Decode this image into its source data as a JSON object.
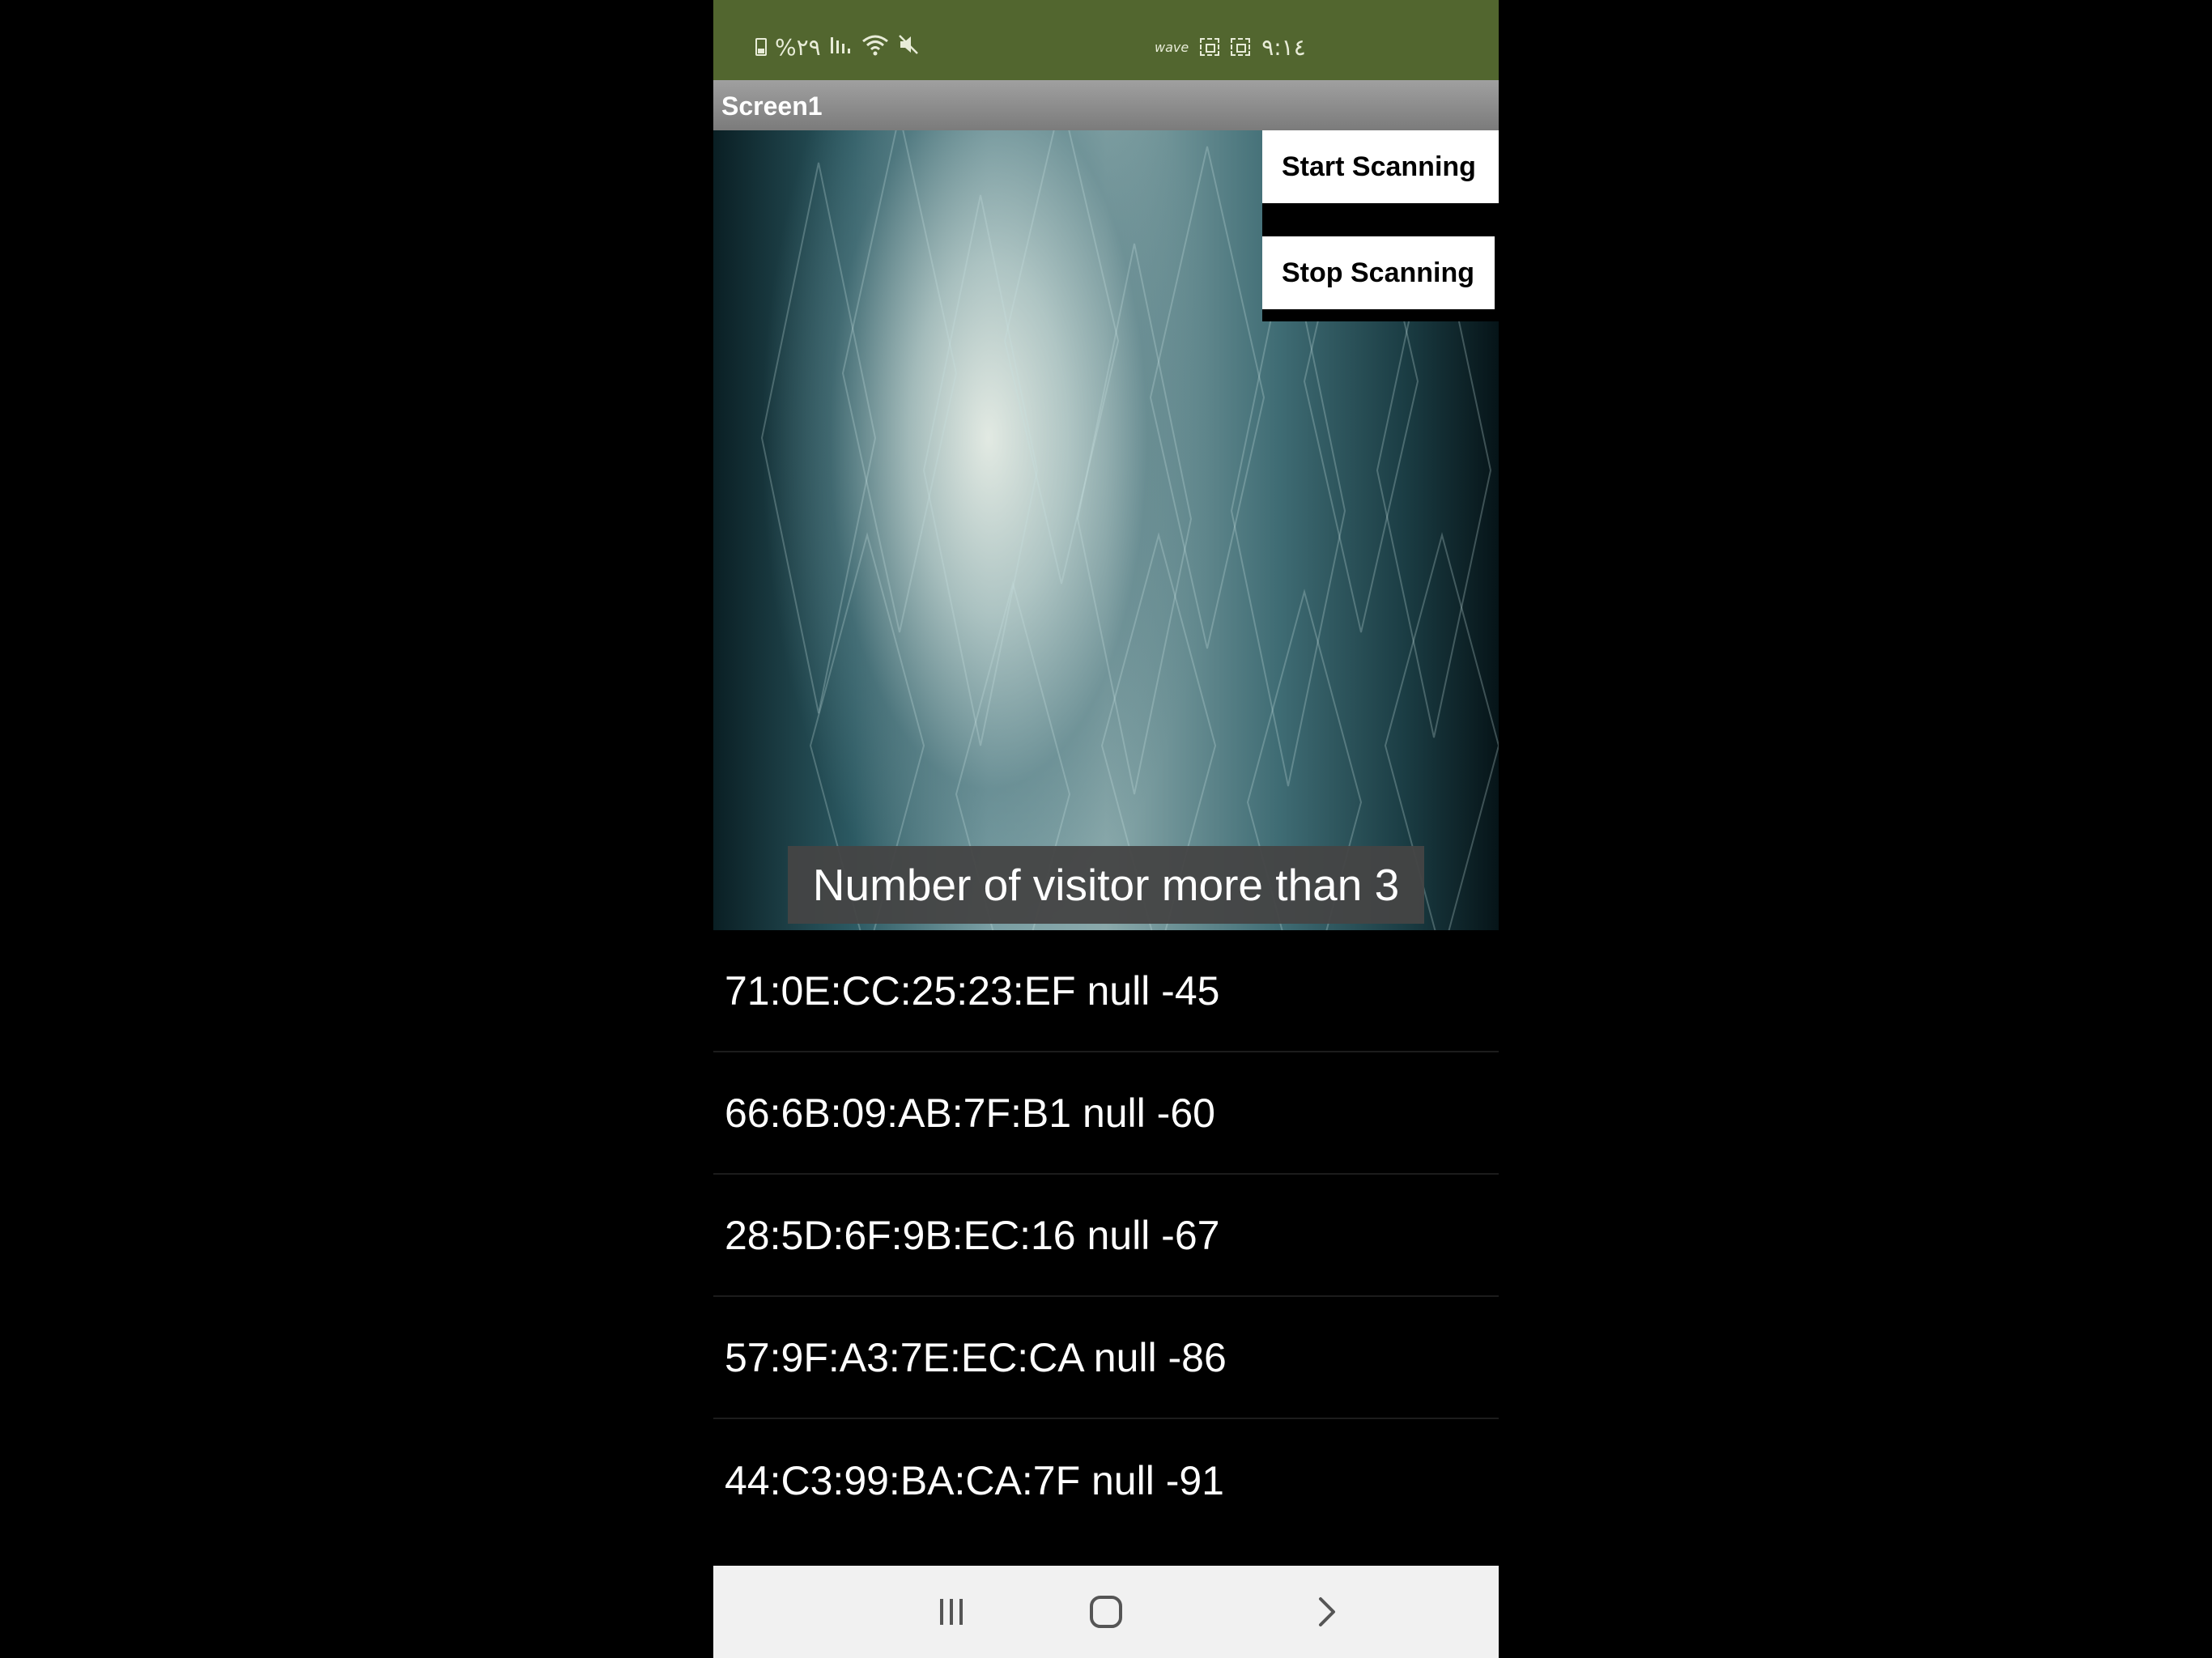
{
  "status_bar": {
    "left_text": "%٢٩",
    "wave_label": "wave",
    "time": "٩:١٤",
    "background_color": "#52662f"
  },
  "app": {
    "title": "Screen1",
    "title_bar_color": "#8a8a8a"
  },
  "buttons": {
    "start_label": "Start Scanning",
    "stop_label": "Stop Scanning"
  },
  "banner": {
    "text": "Number of visitor more than 3"
  },
  "devices": [
    {
      "label": "71:0E:CC:25:23:EF null -45"
    },
    {
      "label": "66:6B:09:AB:7F:B1 null -60"
    },
    {
      "label": "28:5D:6F:9B:EC:16 null -67"
    },
    {
      "label": "57:9F:A3:7E:EC:CA null -86"
    },
    {
      "label": "44:C3:99:BA:CA:7F null -91"
    }
  ],
  "nav": {
    "icons": [
      "recents-icon",
      "home-icon",
      "back-icon"
    ]
  }
}
